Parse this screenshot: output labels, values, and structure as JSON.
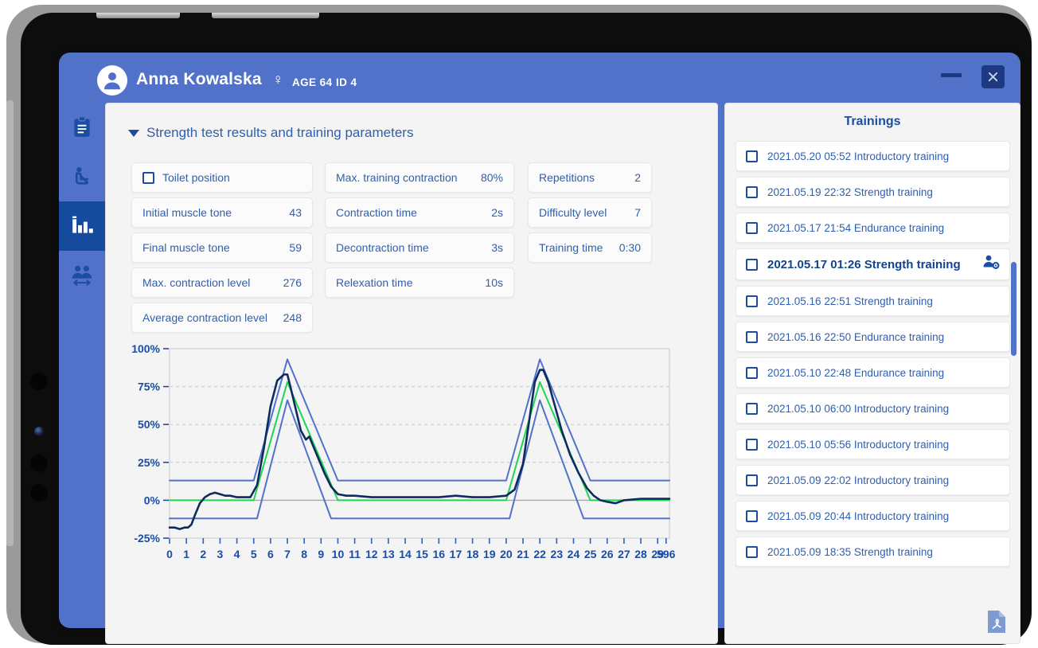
{
  "window": {
    "patient_name": "Anna Kowalska",
    "gender_symbol": "♀",
    "age": "AGE 64",
    "patient_id": "ID 4",
    "minimize_label": "Minimize",
    "close_label": "Close"
  },
  "sidebar": {
    "items": [
      {
        "name": "clipboard",
        "icon": "clipboard-icon",
        "active": false
      },
      {
        "name": "seated-patient",
        "icon": "seated-person-icon",
        "active": false
      },
      {
        "name": "statistics",
        "icon": "bar-chart-icon",
        "active": true
      },
      {
        "name": "patients",
        "icon": "two-people-icon",
        "active": false
      }
    ]
  },
  "main": {
    "section_title": "Strength test results and training parameters",
    "columns": [
      {
        "cards": [
          {
            "label": "Toilet position",
            "value": "",
            "checkbox": true,
            "checked": false
          },
          {
            "label": "Initial muscle tone",
            "value": "43",
            "checkbox": false
          },
          {
            "label": "Final muscle tone",
            "value": "59",
            "checkbox": false
          },
          {
            "label": "Max. contraction level",
            "value": "276",
            "checkbox": false
          },
          {
            "label": "Average contraction level",
            "value": "248",
            "checkbox": false
          }
        ]
      },
      {
        "cards": [
          {
            "label": "Max. training contraction",
            "value": "80%",
            "checkbox": false
          },
          {
            "label": "Contraction time",
            "value": "2s",
            "checkbox": false
          },
          {
            "label": "Decontraction time",
            "value": "3s",
            "checkbox": false
          },
          {
            "label": "Relexation time",
            "value": "10s",
            "checkbox": false
          }
        ]
      },
      {
        "cards": [
          {
            "label": "Repetitions",
            "value": "2",
            "checkbox": false
          },
          {
            "label": "Difficulty level",
            "value": "7",
            "checkbox": false
          },
          {
            "label": "Training time",
            "value": "0:30",
            "checkbox": false
          }
        ]
      }
    ]
  },
  "trainings": {
    "title": "Trainings",
    "items": [
      {
        "label": "2021.05.20 05:52 Introductory training",
        "checked": false,
        "selected": false
      },
      {
        "label": "2021.05.19 22:32 Strength training",
        "checked": false,
        "selected": false
      },
      {
        "label": "2021.05.17 21:54 Endurance training",
        "checked": false,
        "selected": false
      },
      {
        "label": "2021.05.17 01:26 Strength training",
        "checked": false,
        "selected": true
      },
      {
        "label": "2021.05.16 22:51 Strength training",
        "checked": false,
        "selected": false
      },
      {
        "label": "2021.05.16 22:50 Endurance training",
        "checked": false,
        "selected": false
      },
      {
        "label": "2021.05.10 22:48 Endurance training",
        "checked": false,
        "selected": false
      },
      {
        "label": "2021.05.10 06:00 Introductory training",
        "checked": false,
        "selected": false
      },
      {
        "label": "2021.05.10 05:56 Introductory training",
        "checked": false,
        "selected": false
      },
      {
        "label": "2021.05.09 22:02 Introductory training",
        "checked": false,
        "selected": false
      },
      {
        "label": "2021.05.09 20:44 Introductory training",
        "checked": false,
        "selected": false
      },
      {
        "label": "2021.05.09 18:35 Strength training",
        "checked": false,
        "selected": false
      }
    ],
    "export_icon": "pdf-export-icon",
    "row_action_icon": "user-settings-icon"
  },
  "colors": {
    "brand_blue": "#5272ca",
    "dark_blue": "#164a9c",
    "text_blue": "#2f5fae",
    "measured_line": "#0d2b5e",
    "target_line": "#1fd552",
    "band_line": "#5272ca",
    "panel_bg": "#f4f4f5"
  },
  "chart_data": {
    "type": "line",
    "title": "",
    "xlabel": "",
    "ylabel": "",
    "xlim": [
      0,
      29.7
    ],
    "ylim": [
      -25,
      100
    ],
    "grid": true,
    "legend": "none",
    "ytick_labels": [
      "100%",
      "75%",
      "50%",
      "25%",
      "0%",
      "-25%"
    ],
    "ytick_values": [
      100,
      75,
      50,
      25,
      0,
      -25
    ],
    "xtick_labels": [
      "0",
      "1",
      "2",
      "3",
      "4",
      "5",
      "6",
      "7",
      "8",
      "9",
      "10",
      "11",
      "12",
      "13",
      "14",
      "15",
      "16",
      "17",
      "18",
      "19",
      "20",
      "21",
      "22",
      "23",
      "24",
      "25",
      "26",
      "27",
      "28",
      "29",
      "596"
    ],
    "xtick_values": [
      0,
      1,
      2,
      3,
      4,
      5,
      6,
      7,
      8,
      9,
      10,
      11,
      12,
      13,
      14,
      15,
      16,
      17,
      18,
      19,
      20,
      21,
      22,
      23,
      24,
      25,
      26,
      27,
      28,
      29,
      29.5
    ],
    "series": [
      {
        "name": "Target contraction (green)",
        "color": "#1fd552",
        "x": [
          0,
          5,
          7,
          10,
          20,
          22,
          25,
          29.7
        ],
        "values": [
          0,
          0,
          78,
          0,
          0,
          78,
          0,
          0
        ]
      },
      {
        "name": "Upper tolerance band",
        "color": "#5272ca",
        "x": [
          0,
          5,
          7,
          10,
          20,
          22,
          25,
          29.7
        ],
        "values": [
          13,
          13,
          93,
          13,
          13,
          93,
          13,
          13
        ]
      },
      {
        "name": "Lower tolerance band",
        "color": "#5272ca",
        "x": [
          0,
          5.2,
          7,
          9.6,
          20.2,
          22,
          24.6,
          29.7
        ],
        "values": [
          -12,
          -12,
          66,
          -12,
          -12,
          66,
          -12,
          -12
        ]
      },
      {
        "name": "Measured EMG signal",
        "color": "#0d2b5e",
        "x": [
          0.0,
          0.3,
          0.6,
          0.9,
          1.1,
          1.3,
          1.5,
          1.8,
          2.1,
          2.4,
          2.7,
          3.0,
          3.3,
          3.6,
          4.0,
          4.4,
          4.8,
          5.2,
          5.6,
          6.0,
          6.4,
          6.8,
          7.0,
          7.2,
          7.5,
          7.8,
          8.1,
          8.3,
          8.6,
          8.9,
          9.2,
          9.6,
          10.0,
          10.5,
          11.0,
          12.0,
          13.0,
          14.0,
          15.0,
          16.0,
          17.0,
          18.0,
          19.0,
          20.0,
          20.5,
          21.0,
          21.4,
          21.7,
          22.0,
          22.2,
          22.5,
          22.9,
          23.3,
          23.8,
          24.3,
          24.8,
          25.2,
          25.6,
          26.0,
          26.5,
          27.0,
          28.0,
          29.0,
          29.7
        ],
        "values": [
          -18,
          -18,
          -19,
          -18,
          -18,
          -16,
          -10,
          -2,
          2,
          4,
          5,
          4,
          3,
          3,
          2,
          2,
          2,
          10,
          34,
          62,
          79,
          83,
          83,
          74,
          60,
          46,
          40,
          42,
          34,
          26,
          18,
          9,
          4,
          3,
          3,
          2,
          2,
          2,
          2,
          2,
          3,
          2,
          2,
          3,
          7,
          24,
          55,
          78,
          86,
          86,
          78,
          62,
          46,
          30,
          18,
          8,
          3,
          0,
          -1,
          -2,
          0,
          1,
          1,
          1
        ]
      }
    ]
  }
}
